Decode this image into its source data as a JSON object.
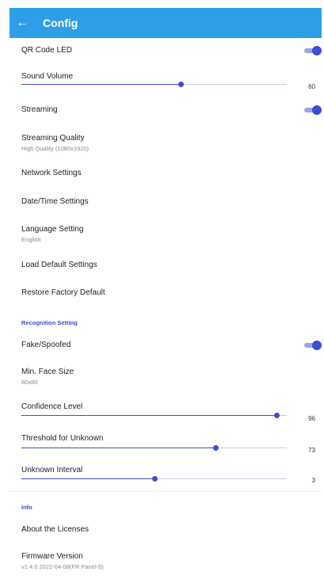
{
  "app_bar": {
    "back_icon": "←",
    "title": "Config"
  },
  "settings": {
    "qr_code_led": {
      "label": "QR Code LED",
      "on": true
    },
    "sound_volume": {
      "label": "Sound Volume",
      "value": "60",
      "level": 0.6
    },
    "streaming": {
      "label": "Streaming",
      "on": true
    },
    "streaming_quality": {
      "label": "Streaming Quality",
      "sub": "High Quality (1080x1920)"
    },
    "network_settings": {
      "label": "Network Settings"
    },
    "date_time_settings": {
      "label": "Date/Time Settings"
    },
    "language_setting": {
      "label": "Language Setting",
      "sub": "English"
    },
    "load_default_settings": {
      "label": "Load Default Settings"
    },
    "restore_factory_default": {
      "label": "Restore Factory Default"
    }
  },
  "recognition": {
    "section_title": "Recognition Setting",
    "fake_spoofed": {
      "label": "Fake/Spoofed",
      "on": true
    },
    "min_face_size": {
      "label": "Min. Face Size",
      "sub": "80x80"
    },
    "confidence_level": {
      "label": "Confidence Level",
      "value": "96",
      "level": 0.96
    },
    "threshold_unknown": {
      "label": "Threshold for Unknown",
      "value": "73",
      "level": 0.73
    },
    "unknown_interval": {
      "label": "Unknown Interval",
      "value": "3",
      "level": 0.5
    }
  },
  "info": {
    "section_title": "Info",
    "about_licenses": {
      "label": "About the Licenses"
    },
    "firmware_version": {
      "label": "Firmware Version",
      "sub": "v1.4.0 2022-04-08(FR Panel-5)"
    }
  },
  "colors": {
    "app_bar": "#2f9ee9",
    "accent": "#3a4fd1",
    "section_title": "#3b4fd6"
  }
}
